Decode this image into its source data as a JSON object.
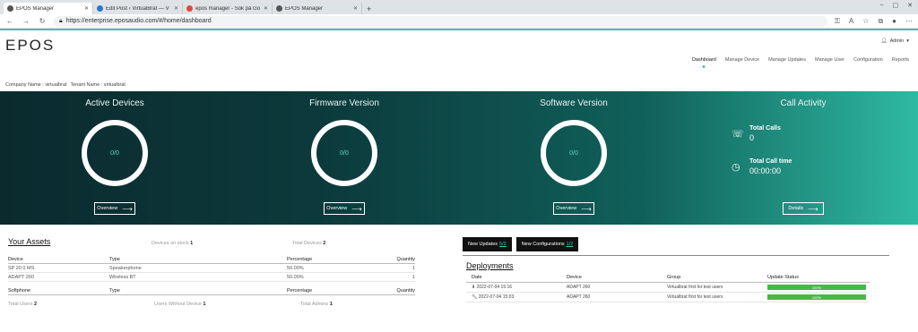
{
  "browser": {
    "tabs": [
      {
        "title": "EPOS Manager",
        "active": true
      },
      {
        "title": "Edit Post ‹ VirtualBrat — V",
        "active": false
      },
      {
        "title": "epos manager - Sök på Go",
        "active": false
      },
      {
        "title": "EPOS Manager",
        "active": false
      }
    ],
    "url": "https://enterprise.eposaudio.com/#/home/dashboard"
  },
  "header": {
    "logo": "EPOS",
    "user": "Admin",
    "nav": [
      "Dashboard",
      "Manage Device",
      "Manage Updates",
      "Manage User",
      "Configuration",
      "Reports"
    ],
    "active_nav": "Dashboard",
    "company": "Company Name : virtualbrat",
    "tenant": "Tenant Name : virtualbrat"
  },
  "hero": {
    "active_devices": {
      "title": "Active Devices",
      "value": "0/0",
      "button": "Overview"
    },
    "firmware": {
      "title": "Firmware Version",
      "value": "0/0",
      "button": "Overview"
    },
    "software": {
      "title": "Software Version",
      "value": "0/0",
      "button": "Overview"
    },
    "calls": {
      "title": "Call Activity",
      "total_calls_label": "Total Calls",
      "total_calls": "0",
      "total_time_label": "Total Call time",
      "total_time": "00:00:00",
      "button": "Details"
    }
  },
  "assets": {
    "title": "Your Assets",
    "on_stock_label": "Devices on stock",
    "on_stock": "1",
    "total_devices_label": "Total Devices",
    "total_devices": "2",
    "columns": [
      "Device",
      "Type",
      "Percentage",
      "Quantity"
    ],
    "rows": [
      {
        "device": "SP 20 0 MS",
        "type": "Speakerphone",
        "percentage": "50.00%",
        "quantity": "1"
      },
      {
        "device": "ADAPT 260",
        "type": "Wireless BT",
        "percentage": "50.00%",
        "quantity": "1"
      }
    ],
    "soft_columns": [
      "Softphone",
      "Type",
      "Percentage",
      "Quantity"
    ],
    "total_users_label": "Total Users",
    "total_users": "2",
    "users_without_label": "Users Without Device",
    "users_without": "1",
    "total_admins_label": "Total Admins",
    "total_admins": "1"
  },
  "deployments": {
    "new_updates_label": "New Updates",
    "new_updates": "5/2",
    "new_configs_label": "New Configurations",
    "new_configs": "1/2",
    "title": "Deployments",
    "columns": [
      "Date",
      "Device",
      "Group",
      "Update Status"
    ],
    "rows": [
      {
        "date": "2022-07-04 15:16",
        "device": "ADAPT 260",
        "group": "Virtualbrat first for test users",
        "status": "100%",
        "progress": 100,
        "icon": "download-icon"
      },
      {
        "date": "2022-07-04 15:03",
        "device": "ADAPT 260",
        "group": "Virtualbrat first for test users",
        "status": "100%",
        "progress": 100,
        "icon": "wrench-icon"
      }
    ]
  },
  "colors": {
    "accent": "#46c2b6",
    "progress": "#46b84a",
    "hero_dark": "#0b2a2e",
    "hero_light": "#2fb9a3"
  }
}
